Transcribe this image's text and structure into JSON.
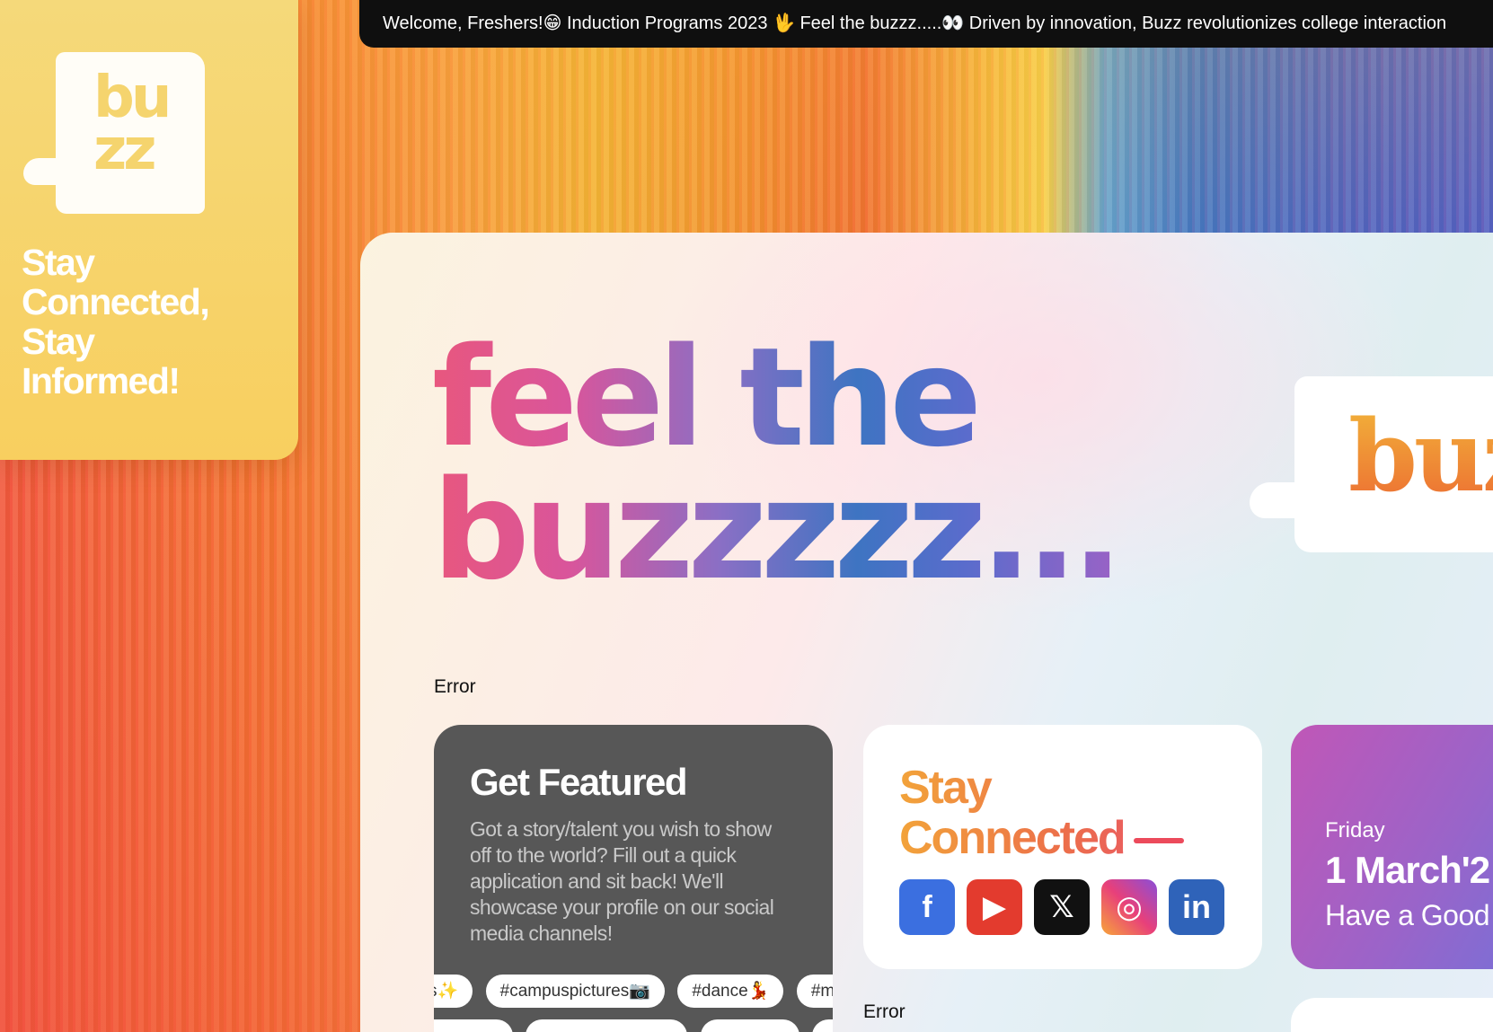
{
  "sidebar": {
    "logo_text": "bu zz",
    "tagline": "Stay Connected, Stay Informed!"
  },
  "ticker": {
    "text": "Welcome, Freshers!😁 Induction Programs 2023 🖖 Feel the buzzz.....👀 Driven by innovation, Buzz revolutionizes college interaction"
  },
  "hero": {
    "line1": "feel the",
    "line2": "buzzzzz..."
  },
  "brand_badge": {
    "text": "buz"
  },
  "errors": {
    "first": "Error",
    "second": "Error"
  },
  "featured": {
    "title": "Get Featured",
    "body": "Got a story/talent you wish to show off to the world? Fill out a quick application and sit back! We'll showcase your profile on our social media channels!",
    "tags": [
      "s✨",
      "#campuspictures📷",
      "#dance💃",
      "#mu"
    ]
  },
  "social": {
    "title_line1": "Stay",
    "title_line2": "Connected",
    "icons": {
      "facebook": "f",
      "youtube": "▶",
      "x": "𝕏",
      "instagram": "◎",
      "linkedin": "in"
    }
  },
  "date_card": {
    "day": "Friday",
    "date": "1 March'2",
    "greeting": "Have a Good"
  },
  "colors": {
    "sidebar": "#f8cf5f",
    "ticker_bg": "#0f0f0f",
    "featured_bg": "#575757",
    "accent_pink": "#e8577e",
    "accent_blue": "#3e74c2"
  }
}
